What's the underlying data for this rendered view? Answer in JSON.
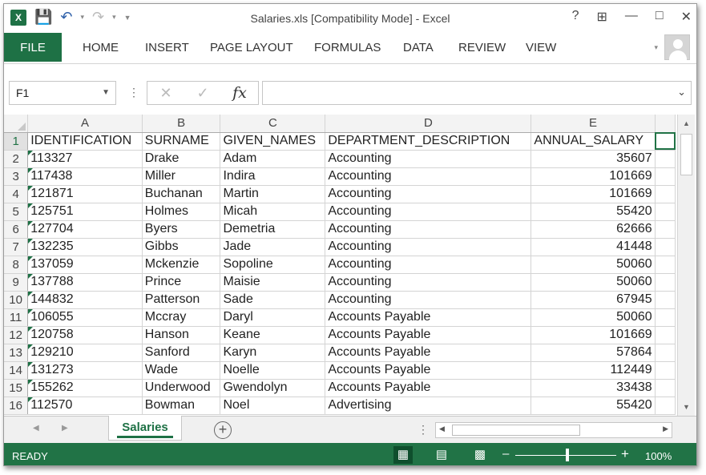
{
  "window": {
    "title": "Salaries.xls  [Compatibility Mode] - Excel"
  },
  "qat": {
    "app_icon": "X"
  },
  "window_controls": {
    "help": "?",
    "ribbon_options": "⊞",
    "minimize": "—",
    "maximize": "□",
    "close": "✕"
  },
  "ribbon": {
    "tabs": [
      "FILE",
      "HOME",
      "INSERT",
      "PAGE LAYOUT",
      "FORMULAS",
      "DATA",
      "REVIEW",
      "VIEW"
    ]
  },
  "formula_bar": {
    "name_box": "F1",
    "formula": "",
    "cancel": "✕",
    "enter": "✓",
    "fx": "fx"
  },
  "grid": {
    "column_letters": [
      "A",
      "B",
      "C",
      "D",
      "E"
    ],
    "row_numbers": [
      "1",
      "2",
      "3",
      "4",
      "5",
      "6",
      "7",
      "8",
      "9",
      "10",
      "11",
      "12",
      "13",
      "14",
      "15",
      "16"
    ],
    "rows": [
      [
        "IDENTIFICATION",
        "SURNAME",
        "GIVEN_NAMES",
        "DEPARTMENT_DESCRIPTION",
        "ANNUAL_SALARY"
      ],
      [
        "113327",
        "Drake",
        "Adam",
        "Accounting",
        "35607"
      ],
      [
        "117438",
        "Miller",
        "Indira",
        "Accounting",
        "101669"
      ],
      [
        "121871",
        "Buchanan",
        "Martin",
        "Accounting",
        "101669"
      ],
      [
        "125751",
        "Holmes",
        "Micah",
        "Accounting",
        "55420"
      ],
      [
        "127704",
        "Byers",
        "Demetria",
        "Accounting",
        "62666"
      ],
      [
        "132235",
        "Gibbs",
        "Jade",
        "Accounting",
        "41448"
      ],
      [
        "137059",
        "Mckenzie",
        "Sopoline",
        "Accounting",
        "50060"
      ],
      [
        "137788",
        "Prince",
        "Maisie",
        "Accounting",
        "50060"
      ],
      [
        "144832",
        "Patterson",
        "Sade",
        "Accounting",
        "67945"
      ],
      [
        "106055",
        "Mccray",
        "Daryl",
        "Accounts Payable",
        "50060"
      ],
      [
        "120758",
        "Hanson",
        "Keane",
        "Accounts Payable",
        "101669"
      ],
      [
        "129210",
        "Sanford",
        "Karyn",
        "Accounts Payable",
        "57864"
      ],
      [
        "131273",
        "Wade",
        "Noelle",
        "Accounts Payable",
        "112449"
      ],
      [
        "155262",
        "Underwood",
        "Gwendolyn",
        "Accounts Payable",
        "33438"
      ],
      [
        "112570",
        "Bowman",
        "Noel",
        "Advertising",
        "55420"
      ]
    ]
  },
  "sheets": {
    "active_tab": "Salaries",
    "add_symbol": "+"
  },
  "status": {
    "ready": "READY",
    "zoom": "100%",
    "zoom_level": 1.0
  },
  "colors": {
    "excel_green": "#217346",
    "tab_green": "#1e7145",
    "gridline": "#d4d4d4"
  }
}
